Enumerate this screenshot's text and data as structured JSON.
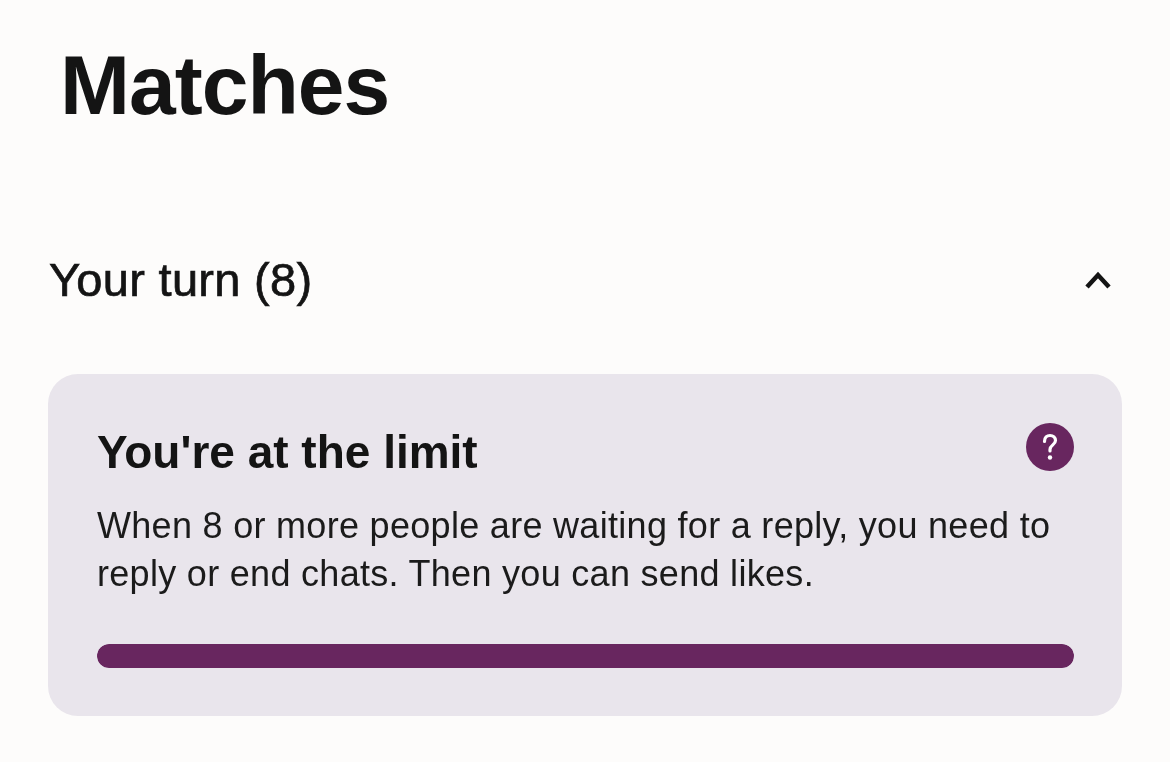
{
  "header": {
    "title": "Matches"
  },
  "section": {
    "title": "Your turn (8)",
    "expanded": true,
    "notice": {
      "title": "You're at the limit",
      "text": "When 8 or more people are waiting for a reply, you need to reply or end chats. Then you can send likes.",
      "progress": {
        "level": 1
      }
    }
  }
}
